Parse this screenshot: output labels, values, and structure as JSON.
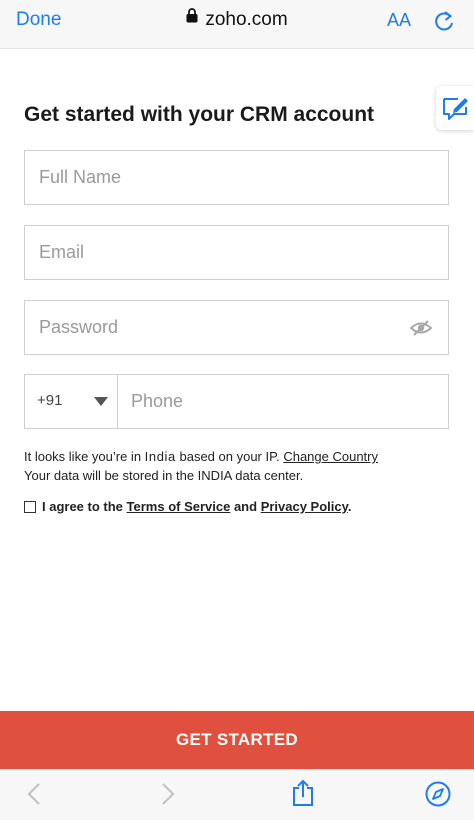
{
  "browser": {
    "done_label": "Done",
    "url": "zoho.com",
    "text_size_label": "AA",
    "lock_icon": "lock-icon",
    "reload_icon": "reload-icon"
  },
  "feedback_icon": "edit-feedback-icon",
  "form": {
    "title": "Get started with your CRM account",
    "full_name_placeholder": "Full Name",
    "email_placeholder": "Email",
    "password_placeholder": "Password",
    "country_code": "+91",
    "phone_placeholder": "Phone"
  },
  "location_note": {
    "prefix": "It looks like you’re in ",
    "country": "India",
    "middle": " based on your IP. ",
    "change_link": "Change Country",
    "storage_line": "Your data will be stored in the INDIA data center."
  },
  "agreement": {
    "prefix": "I agree to the ",
    "terms_link": "Terms of Service",
    "and": " and ",
    "privacy_link": "Privacy Policy",
    "suffix": "."
  },
  "cta_label": "GET STARTED",
  "toolbar": {
    "back_icon": "chevron-left-icon",
    "forward_icon": "chevron-right-icon",
    "share_icon": "share-icon",
    "compass_icon": "compass-icon"
  },
  "colors": {
    "accent_blue": "#1e7cf2",
    "cta_red": "#e0503f"
  }
}
